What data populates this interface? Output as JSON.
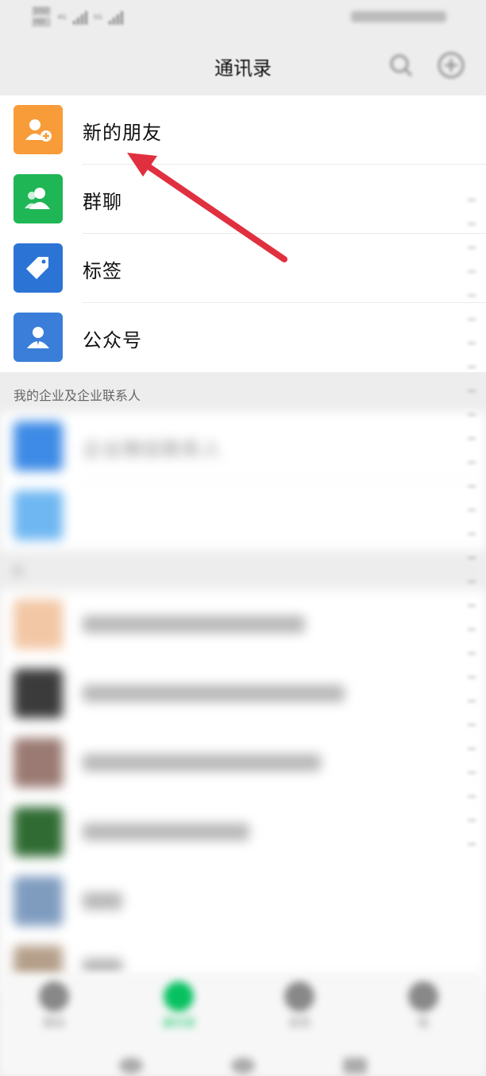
{
  "status_bar": {
    "chip_top": "SSD",
    "chip_bottom": "HD",
    "net1": "4G",
    "net2": "5G"
  },
  "header": {
    "title": "通讯录",
    "icons": [
      "search-icon",
      "add-icon"
    ]
  },
  "top_items": [
    {
      "label": "新的朋友",
      "icon": "add-friend-icon",
      "color": "#f79c38"
    },
    {
      "label": "群聊",
      "icon": "group-chat-icon",
      "color": "#1fb656"
    },
    {
      "label": "标签",
      "icon": "tag-icon",
      "color": "#2b74d6"
    },
    {
      "label": "公众号",
      "icon": "official-account-icon",
      "color": "#3a7ed9"
    }
  ],
  "section_enterprise": {
    "title": "我的企业及企业联系人"
  },
  "enterprise_items": [
    {
      "label": "企业微信联系人"
    },
    {
      "label": ""
    }
  ],
  "section_a": {
    "title": "A"
  },
  "tab_bar": {
    "tabs": [
      {
        "label": "微信"
      },
      {
        "label": "通讯录"
      },
      {
        "label": "发现"
      },
      {
        "label": "我"
      }
    ]
  },
  "colors": {
    "annotation_arrow": "#e0303f",
    "active_tab": "#07c160"
  }
}
